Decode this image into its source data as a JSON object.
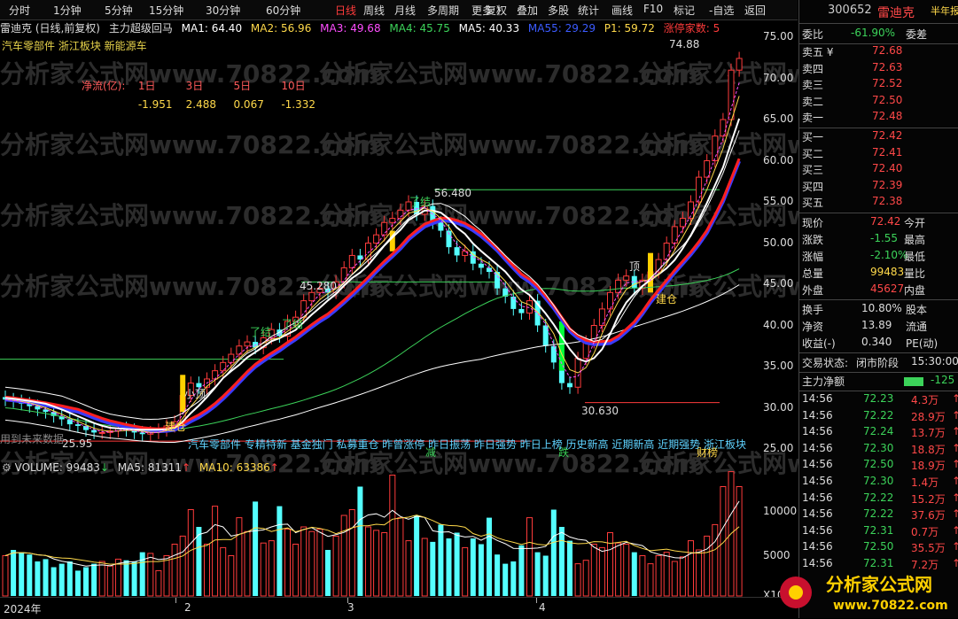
{
  "toolbar": {
    "left_items": [
      "分时",
      "1分钟",
      "5分钟",
      "15分钟",
      "30分钟",
      "60分钟",
      "日线",
      "周线",
      "月线",
      "多周期",
      "更多 〉"
    ],
    "active": "日线",
    "right_items": [
      "复权",
      "叠加",
      "多股",
      "统计",
      "画线",
      "F10",
      "标记",
      "-自选",
      "返回"
    ]
  },
  "stock": {
    "code": "300652",
    "name": "雷迪克",
    "tag": "半年报"
  },
  "indicator_row": {
    "title": "雷迪克 (日线,前复权)",
    "formula": "主力超级回马",
    "ma1": "MA1: 64.40",
    "ma2": "MA2: 56.96",
    "ma3": "MA3: 49.68",
    "ma4": "MA4: 45.75",
    "ma5": "MA5: 40.33",
    "ma55": "MA55: 29.29",
    "p1": "P1: 59.72",
    "zt": "涨停家数: 5",
    "colors": {
      "ma1": "#ffffff",
      "ma2": "#ffd94a",
      "ma3": "#ff4dff",
      "ma4": "#3cd35a",
      "ma5": "#ffffff",
      "ma55": "#3b5bff",
      "p1": "#ffd94a",
      "zt": "#ff3b3b"
    }
  },
  "concepts": "汽车零部件 浙江板块 新能源车",
  "net_flow": {
    "label": "净流(亿):",
    "periods": [
      "1日",
      "3日",
      "5日",
      "10日"
    ],
    "values": [
      "-1.951",
      "2.488",
      "0.067",
      "-1.332"
    ]
  },
  "annotations": {
    "price_high": "74.88",
    "peak1": "56.480",
    "peak2": "45.280",
    "low1": "30.630",
    "low0": "25.95",
    "text_le": [
      "了结",
      "了结",
      "了结"
    ],
    "text_jc": [
      "建仓",
      "建仓"
    ],
    "small_top": "小顶",
    "top2": "顶",
    "jian": "减",
    "die": "跌",
    "cai": "财榜",
    "left_note": "用到未来数据"
  },
  "events": "汽车零部件  专精特新  基金独门  私募重仓  昨曾涨停  昨日振荡  昨日强势  昨日上榜  历史新高  近期新高  近期强势  浙江板块",
  "price_axis": [
    "75.00",
    "70.00",
    "65.00",
    "60.00",
    "55.00",
    "50.00",
    "45.00",
    "40.00",
    "35.00",
    "30.00",
    "25.00"
  ],
  "volume": {
    "label": "VOLUME: 99483",
    "ma5": "MA5: 81311",
    "ma10": "MA10: 63386",
    "axis": [
      "10000",
      "5000",
      "X10"
    ]
  },
  "date_axis": [
    "2024年",
    "2",
    "3",
    "4"
  ],
  "panel": {
    "webi": {
      "k": "委比",
      "v": "-61.90%",
      "k2": "委差"
    },
    "sell": [
      {
        "k": "卖五 ¥",
        "v": "72.68"
      },
      {
        "k": "卖四",
        "v": "72.63"
      },
      {
        "k": "卖三",
        "v": "72.52"
      },
      {
        "k": "卖二",
        "v": "72.50"
      },
      {
        "k": "卖一",
        "v": "72.48"
      }
    ],
    "buy": [
      {
        "k": "买一",
        "v": "72.42"
      },
      {
        "k": "买二",
        "v": "72.41"
      },
      {
        "k": "买三",
        "v": "72.40"
      },
      {
        "k": "买四",
        "v": "72.39"
      },
      {
        "k": "买五",
        "v": "72.38"
      }
    ],
    "quote": [
      {
        "k": "现价",
        "v": "72.42",
        "k2": "今开",
        "c": "red"
      },
      {
        "k": "涨跌",
        "v": "-1.55",
        "k2": "最高",
        "c": "green"
      },
      {
        "k": "涨幅",
        "v": "-2.10%",
        "k2": "最低",
        "c": "green"
      },
      {
        "k": "总量",
        "v": "99483",
        "k2": "量比",
        "c": "yellow"
      },
      {
        "k": "外盘",
        "v": "45627",
        "k2": "内盘",
        "c": "red"
      }
    ],
    "fin": [
      {
        "k": "换手",
        "v": "10.80%",
        "k2": "股本"
      },
      {
        "k": "净资",
        "v": "13.89",
        "k2": "流通"
      },
      {
        "k": "收益(-)",
        "v": "0.340",
        "k2": "PE(动)"
      }
    ],
    "trade_state": {
      "k": "交易状态:",
      "v": "闭市阶段",
      "t": "15:30:00"
    },
    "main_flow": {
      "k": "主力净额",
      "v": "-125"
    },
    "ticks": [
      {
        "t": "14:56",
        "p": "72.23",
        "v": "4.3万",
        "c": "green"
      },
      {
        "t": "14:56",
        "p": "72.22",
        "v": "28.9万",
        "c": "green"
      },
      {
        "t": "14:56",
        "p": "72.24",
        "v": "13.7万",
        "c": "green"
      },
      {
        "t": "14:56",
        "p": "72.30",
        "v": "18.8万",
        "c": "green"
      },
      {
        "t": "14:56",
        "p": "72.50",
        "v": "18.9万",
        "c": "green"
      },
      {
        "t": "14:56",
        "p": "72.30",
        "v": "1.4万",
        "c": "green"
      },
      {
        "t": "14:56",
        "p": "72.22",
        "v": "15.2万",
        "c": "green"
      },
      {
        "t": "14:56",
        "p": "72.22",
        "v": "37.6万",
        "c": "green"
      },
      {
        "t": "14:56",
        "p": "72.31",
        "v": "0.7万",
        "c": "green"
      },
      {
        "t": "14:56",
        "p": "72.50",
        "v": "35.5万",
        "c": "green"
      },
      {
        "t": "14:56",
        "p": "72.31",
        "v": "7.2万",
        "c": "green"
      }
    ]
  },
  "logo": {
    "title": "分析家公式网",
    "url": "www.70822.com"
  },
  "watermark": "分析家公式网www.70822.com",
  "chart_data": {
    "type": "candlestick",
    "x_labels": [
      "2024年",
      "2",
      "3",
      "4"
    ],
    "ylim": [
      25,
      75
    ],
    "y_ticks": [
      25,
      30,
      35,
      40,
      45,
      50,
      55,
      60,
      65,
      70,
      75
    ],
    "close": [
      31.0,
      30.8,
      30.5,
      30.2,
      29.8,
      29.5,
      29.0,
      28.6,
      28.0,
      27.8,
      27.3,
      27.0,
      27.0,
      27.2,
      27.5,
      27.3,
      27.0,
      26.8,
      27.0,
      27.3,
      27.8,
      28.3,
      31.5,
      33.0,
      32.5,
      33.5,
      34.5,
      35.5,
      36.5,
      37.5,
      38.0,
      37.3,
      38.5,
      39.5,
      38.7,
      40.5,
      41.0,
      43.0,
      44.0,
      44.5,
      44.0,
      45.3,
      47.0,
      48.5,
      48.0,
      50.0,
      51.0,
      52.5,
      53.0,
      54.0,
      55.0,
      53.5,
      54.5,
      52.5,
      51.5,
      49.5,
      48.5,
      49.0,
      47.5,
      47.0,
      46.5,
      44.5,
      43.5,
      42.0,
      41.5,
      43.0,
      40.0,
      37.5,
      35.5,
      33.0,
      32.5,
      36.0,
      38.0,
      40.0,
      42.0,
      44.0,
      45.5,
      46.0,
      44.5,
      45.5,
      46.5,
      48.0,
      50.0,
      52.0,
      53.0,
      55.0,
      58.0,
      60.0,
      63.0,
      65.0,
      71.0,
      72.42
    ],
    "volume": [
      3500,
      4000,
      3800,
      3600,
      3000,
      3200,
      2500,
      2800,
      3000,
      2200,
      2500,
      2800,
      3000,
      2600,
      3200,
      3100,
      3000,
      3800,
      3700,
      2200,
      3500,
      4500,
      5200,
      7500,
      6000,
      4500,
      7800,
      4200,
      3500,
      6800,
      5600,
      8200,
      4600,
      4800,
      7800,
      5800,
      4500,
      6000,
      5600,
      5800,
      4000,
      5200,
      7000,
      7500,
      9500,
      6000,
      5700,
      5500,
      10500,
      6800,
      4800,
      7000,
      5000,
      4700,
      6200,
      5000,
      5500,
      4200,
      5000,
      4500,
      6800,
      3600,
      2800,
      3000,
      4400,
      6800,
      3800,
      3500,
      7500,
      6000,
      4800,
      2800,
      3100,
      4500,
      4200,
      5500,
      4600,
      4500,
      3800,
      3500,
      2800,
      3500,
      3800,
      3000,
      3400,
      4800,
      4000,
      5200,
      6200,
      9500,
      10800,
      9500
    ]
  }
}
